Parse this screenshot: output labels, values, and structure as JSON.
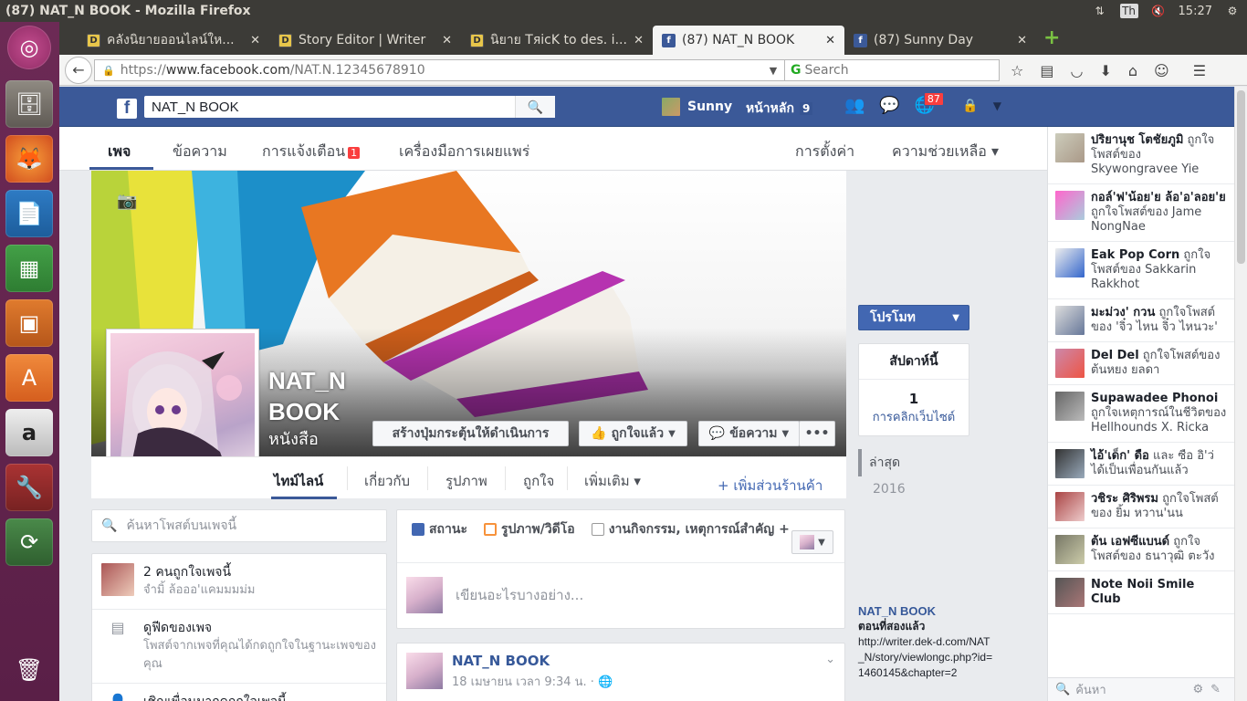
{
  "window": {
    "title": "(87) NAT_N BOOK - Mozilla Firefox",
    "clock": "15:27",
    "lang": "Th"
  },
  "tabs": [
    {
      "label": "คลังนิยายออนไลน์ให...",
      "icon": "d"
    },
    {
      "label": "Story Editor | Writer",
      "icon": "d"
    },
    {
      "label": "นิยาย TяicK to des. i...",
      "icon": "d"
    },
    {
      "label": "(87) NAT_N BOOK",
      "icon": "f",
      "active": true
    },
    {
      "label": "(87) Sunny Day",
      "icon": "f"
    }
  ],
  "urlbar": {
    "prefix": "https://",
    "host": "www.facebook.com",
    "path": "/NAT.N.12345678910"
  },
  "searchbar": {
    "placeholder": "Search"
  },
  "fb": {
    "search_value": "NAT_N BOOK",
    "user": "Sunny",
    "home": "หน้าหลัก",
    "home_count": "9",
    "notif_count": "87"
  },
  "pagenav": {
    "page": "เพจ",
    "messages": "ข้อความ",
    "notifications": "การแจ้งเตือน",
    "notif_count": "1",
    "publishing": "เครื่องมือการเผยแพร่",
    "settings": "การตั้งค่า",
    "help": "ความช่วยเหลือ ▾"
  },
  "profile": {
    "name_line1": "NAT_N",
    "name_line2": "BOOK",
    "category": "หนังสือ"
  },
  "cover_buttons": {
    "cta": "สร้างปุ่มกระตุ้นให้ดำเนินการ",
    "liked": "ถูกใจแล้ว",
    "message": "ข้อความ",
    "more": "•••"
  },
  "timeline_tabs": {
    "timeline": "ไทม์ไลน์",
    "about": "เกี่ยวกับ",
    "photos": "รูปภาพ",
    "likes": "ถูกใจ",
    "more": "เพิ่มเติม ▾",
    "add_shop": "+ เพิ่มส่วนร้านค้า"
  },
  "left": {
    "search_placeholder": "ค้นหาโพสต์บนเพจนี้",
    "likes": "2 คนถูกใจเพจนี้",
    "likes_sub": "จำมิ้ ล้อออ'แคมมมม่ม",
    "feed": "ดูฟีดของเพจ",
    "feed_sub": "โพสต์จากเพจที่คุณได้กดถูกใจในฐานะเพจของคุณ",
    "invite": "เชิญเพื่อนมากดถูกใจเพจนี้"
  },
  "composer": {
    "status": "สถานะ",
    "photo": "รูปภาพ/วิดีโอ",
    "event": "งานกิจกรรม, เหตุการณ์สำคัญ +",
    "placeholder": "เขียนอะไรบางอย่าง..."
  },
  "post": {
    "author": "NAT_N BOOK",
    "date": "18 เมษายน เวลา 9:34 น. · "
  },
  "right": {
    "promote": "โปรโมท",
    "week": "สัปดาห์นี้",
    "clicks": "1",
    "clicks_label": "การคลิกเว็บไซต์",
    "recent": "ล่าสุด",
    "year": "2016",
    "link_name": "NAT_N BOOK",
    "link_title": "ตอนที่สองแล้ว",
    "link_url": "http://writer.dek-d.com/NAT_N/story/viewlongc.php?id=1460145&chapter=2"
  },
  "ticker": [
    {
      "name": "ปริยานุช โตชัยภูมิ",
      "text": " ถูกใจโพสต์ของ Skywongravee Yie"
    },
    {
      "name": "กอล์'ฟ'น้อย'ย ล้อ'อ'ลอย'ย",
      "text": " ถูกใจโพสต์ของ Jame NongNae"
    },
    {
      "name": "Eak Pop Corn",
      "text": " ถูกใจโพสต์ของ Sakkarin Rakkhot"
    },
    {
      "name": "มะม่วง' กวน",
      "text": " ถูกใจโพสต์ของ 'จิ๋ว ไหน จิ๋ว ไหนวะ'"
    },
    {
      "name": "Del Del",
      "text": " ถูกใจโพสต์ของ ต้นหยง ยลดา"
    },
    {
      "name": "Supawadee Phonoi",
      "text": " ถูกใจเหตุการณ์ในชีวิตของ Hellhounds X. Ricka"
    },
    {
      "name": "ไอ้'เด็ก' ดือ",
      "text": " และ ซือ อิ'ว่ ได้เป็นเพื่อนกันแล้ว"
    },
    {
      "name": "วชิระ ศิริพรม",
      "text": " ถูกใจโพสต์ของ ยิ้ม หวาน'นน"
    },
    {
      "name": "ต้น เอฟซีแบนด์",
      "text": " ถูกใจโพสต์ของ ธนาวุฒิ ตะวัง"
    },
    {
      "name": "Note Noii Smile Club",
      "text": ""
    }
  ],
  "chat": {
    "search": "ค้นหา"
  }
}
